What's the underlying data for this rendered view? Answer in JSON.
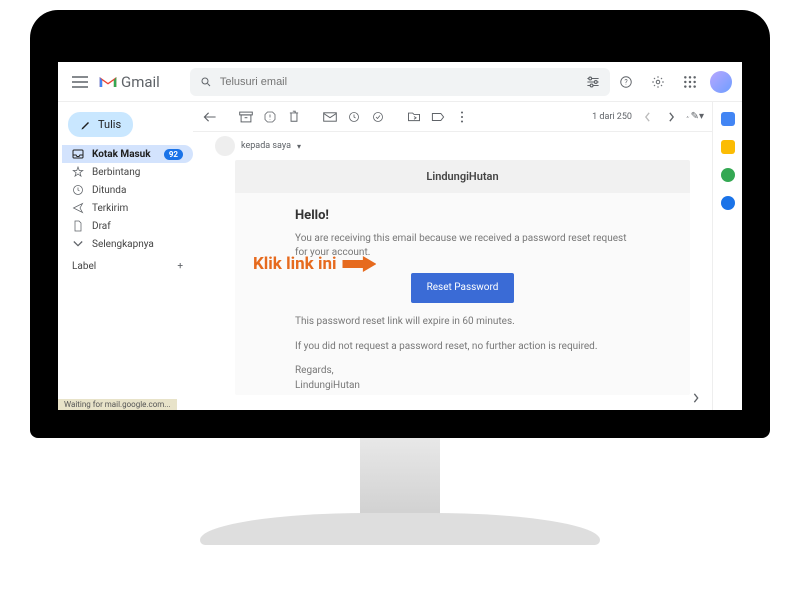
{
  "app": {
    "name": "Gmail"
  },
  "search": {
    "placeholder": "Telusuri email"
  },
  "compose": {
    "label": "Tulis"
  },
  "sidebar": {
    "items": [
      {
        "label": "Kotak Masuk",
        "icon": "inbox-icon",
        "count": "92",
        "active": true
      },
      {
        "label": "Berbintang",
        "icon": "star-icon"
      },
      {
        "label": "Ditunda",
        "icon": "clock-icon"
      },
      {
        "label": "Terkirim",
        "icon": "send-icon"
      },
      {
        "label": "Draf",
        "icon": "file-icon"
      },
      {
        "label": "Selengkapnya",
        "icon": "chevron-down-icon"
      }
    ],
    "labels_header": "Label"
  },
  "toolbar": {
    "pager": "1 dari 250"
  },
  "email": {
    "to_line": "kepada saya",
    "sender_brand": "LindungiHutan",
    "greeting": "Hello!",
    "intro": "You are receiving this email because we received a password reset request for your account.",
    "button_label": "Reset Password",
    "expiry": "This password reset link will expire in 60 minutes.",
    "not_requested": "If you did not request a password reset, no further action is required.",
    "regards": "Regards,",
    "signature": "LindungiHutan"
  },
  "annotation": {
    "text": "Klik link ini"
  },
  "status": "Waiting for mail.google.com..."
}
